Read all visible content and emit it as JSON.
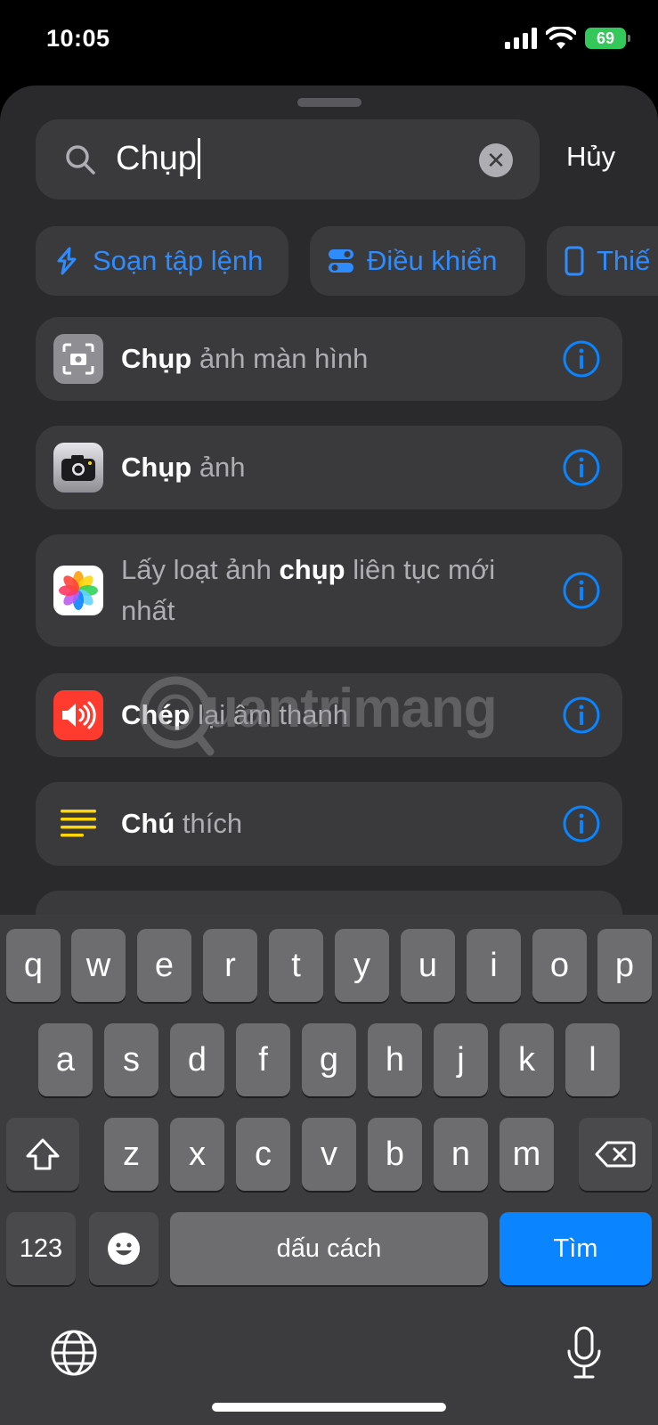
{
  "status_bar": {
    "time": "10:05",
    "battery": "69"
  },
  "search": {
    "query": "Chụp",
    "cancel_label": "Hủy"
  },
  "chips": [
    {
      "label": "Soạn tập lệnh",
      "icon": "scripting-icon"
    },
    {
      "label": "Điều khiển",
      "icon": "toggle-icon"
    },
    {
      "label": "Thiế",
      "icon": "device-icon"
    }
  ],
  "results": [
    {
      "bold": "Chụp",
      "rest": " ảnh màn hình",
      "icon": "screenshot-icon"
    },
    {
      "bold": "Chụp",
      "rest": " ảnh",
      "icon": "camera-icon"
    },
    {
      "pre": "Lấy loạt ảnh ",
      "bold": "chụp",
      "rest": " liên tục mới nhất",
      "icon": "photos-icon"
    },
    {
      "bold": "Chép",
      "rest": " lại âm thanh",
      "icon": "sound-icon"
    },
    {
      "bold": "Chú",
      "rest": " thích",
      "icon": "notes-icon"
    }
  ],
  "keyboard": {
    "row1": [
      "q",
      "w",
      "e",
      "r",
      "t",
      "y",
      "u",
      "i",
      "o",
      "p"
    ],
    "row2": [
      "a",
      "s",
      "d",
      "f",
      "g",
      "h",
      "j",
      "k",
      "l"
    ],
    "row3": [
      "z",
      "x",
      "c",
      "v",
      "b",
      "n",
      "m"
    ],
    "numbers_key": "123",
    "space_label": "dấu cách",
    "return_label": "Tìm"
  },
  "watermark": "uantrimang",
  "colors": {
    "accent": "#0a84ff",
    "sheet": "#2a2a2c",
    "cell": "#3a3a3c"
  }
}
